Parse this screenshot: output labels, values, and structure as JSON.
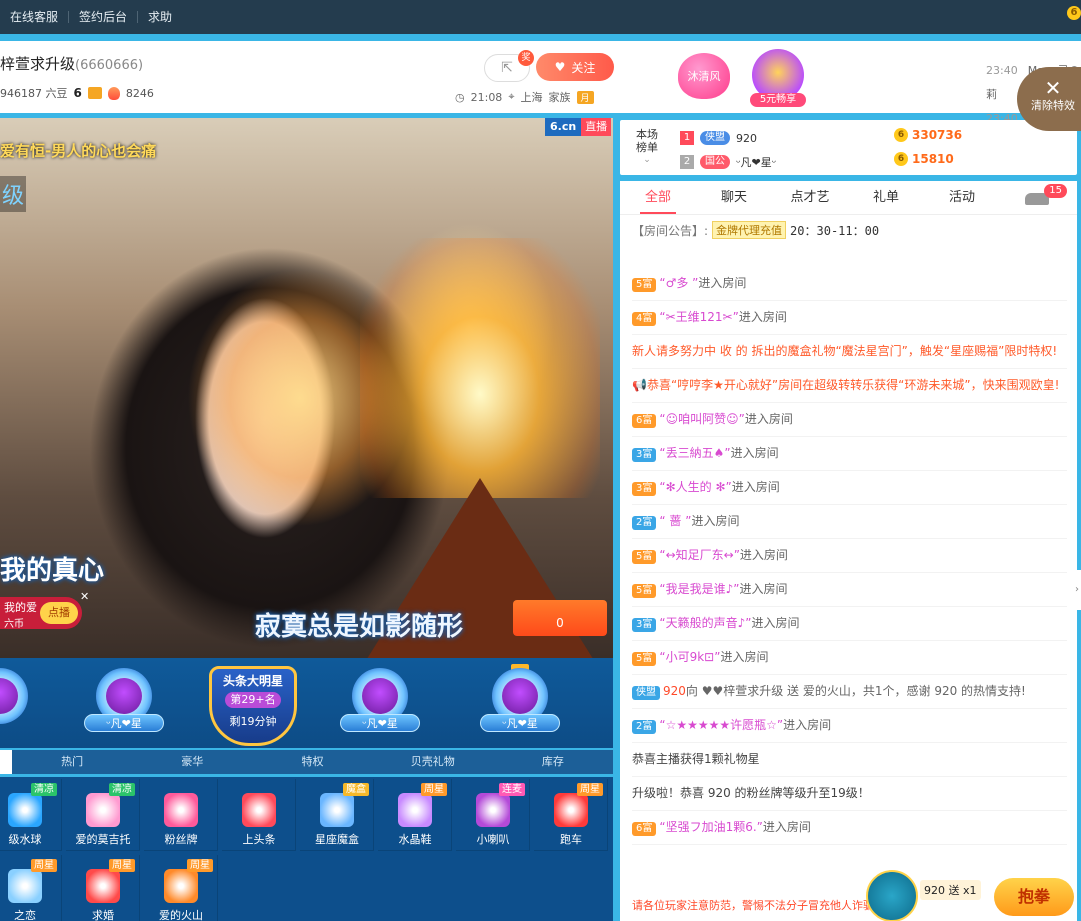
{
  "topbar": {
    "links": [
      "在线客服",
      "签约后台",
      "求助"
    ],
    "coin": "6"
  },
  "header": {
    "title": "梓萱求升级",
    "room_id": "(6660666)",
    "meta_id": "946187 六豆",
    "level": "6",
    "hot": "8246",
    "reward_badge": "奖",
    "follow_label": "关注",
    "time": "21:08",
    "location": "上海",
    "family": "家族",
    "month_tag": "月",
    "gift1_name": "沐清风",
    "gift2_label": "5元畅享",
    "chat_preview": [
      {
        "time": "23:40",
        "name": "Mars 灵の莉"
      },
      {
        "time": "23:40",
        "name": ""
      }
    ],
    "clear_fx": "清除特效"
  },
  "video": {
    "top_text": "爱有恒-男人的心也会痛",
    "lvl_text": "级",
    "logo_a": "6.cn",
    "logo_b": "直播",
    "lyric1": "我的真心",
    "lyric2": "寂寞总是如影随形",
    "promo_title": "我的爱",
    "promo_sub": "六币",
    "promo_btn": "点播",
    "pk_value": "0"
  },
  "seats": [
    {
      "name": "ᵕ凡❤星"
    },
    {
      "name": "ᵕ凡❤星"
    },
    {
      "name": "ᵕ凡❤星"
    },
    {
      "name": "ᵕ凡❤星"
    }
  ],
  "champion": {
    "title": "头条大明星",
    "rank": "第29+名",
    "remaining": "剩19分钟"
  },
  "gift_tabs": [
    "热门",
    "豪华",
    "特权",
    "贝壳礼物",
    "库存"
  ],
  "gifts": [
    {
      "label": "级水球",
      "tag": "清凉",
      "tag_type": "green",
      "color": "#2aa6ff"
    },
    {
      "label": "爱的莫吉托",
      "tag": "清凉",
      "tag_type": "green",
      "color": "#ff9ad0"
    },
    {
      "label": "粉丝牌",
      "tag": "",
      "tag_type": "",
      "color": "#ff5a9a"
    },
    {
      "label": "上头条",
      "tag": "",
      "tag_type": "",
      "color": "#ff4a5a"
    },
    {
      "label": "星座魔盒",
      "tag": "魔盒",
      "tag_type": "gold",
      "color": "#6ab6ff"
    },
    {
      "label": "水晶鞋",
      "tag": "周星",
      "tag_type": "orange",
      "color": "#c88aff"
    },
    {
      "label": "小喇叭",
      "tag": "连麦",
      "tag_type": "pink",
      "color": "#b44ad8"
    },
    {
      "label": "跑车",
      "tag": "周星",
      "tag_type": "orange",
      "color": "#ff3a3a"
    },
    {
      "label": "之恋",
      "tag": "周星",
      "tag_type": "orange",
      "color": "#8ad0ff"
    },
    {
      "label": "求婚",
      "tag": "周星",
      "tag_type": "orange",
      "color": "#ff4a4a"
    },
    {
      "label": "爱的火山",
      "tag": "周星",
      "tag_type": "orange",
      "color": "#ff8a2a"
    }
  ],
  "rank": {
    "label_line1": "本场",
    "label_line2": "榜单",
    "rows": [
      {
        "num": "1",
        "badge": "侠盟",
        "badge_type": "blue",
        "name": "920",
        "coins": "330736"
      },
      {
        "num": "2",
        "badge": "国公",
        "badge_type": "red",
        "name": "ᵕ凡❤星ᵕ",
        "coins": "15810"
      }
    ]
  },
  "chat": {
    "tabs": [
      "全部",
      "聊天",
      "点才艺",
      "礼单",
      "活动"
    ],
    "car_badge": "15",
    "notice_label": "【房间公告】:",
    "notice_gold": "金牌代理充值",
    "notice_time": "20：30-11：00",
    "messages": [
      {
        "rank": "5富",
        "rank_type": "orange",
        "user": "“♂多 ”",
        "text": "进入房间"
      },
      {
        "rank": "4富",
        "rank_type": "orange",
        "user": "“✂王维121✂”",
        "text": "进入房间"
      },
      {
        "rank": "",
        "rank_type": "",
        "user": "",
        "text": "新人请多努力中 收 的 拆出的魔盒礼物“魔法星宫门”，触发“星座赐福”限时特权!",
        "style": "sys"
      },
      {
        "rank": "",
        "rank_type": "",
        "user": "",
        "text": "📢恭喜“哼哼李★开心就好”房间在超级转转乐获得“环游未来城”，快来围观欧皇!",
        "style": "sys"
      },
      {
        "rank": "6富",
        "rank_type": "orange",
        "user": "“☺咱叫阿赞☺”",
        "text": "进入房间"
      },
      {
        "rank": "3富",
        "rank_type": "blue",
        "user": "“丢三納五♠”",
        "text": "进入房间"
      },
      {
        "rank": "3富",
        "rank_type": "orange",
        "user": "“✻人生的 ✻”",
        "text": "进入房间"
      },
      {
        "rank": "2富",
        "rank_type": "blue",
        "user": "“ 蔷 ”",
        "text": "进入房间"
      },
      {
        "rank": "5富",
        "rank_type": "orange",
        "user": "“↔知足厂东↔”",
        "text": "进入房间"
      },
      {
        "rank": "5富",
        "rank_type": "orange",
        "user": "“我是我是谁♪”",
        "text": "进入房间"
      },
      {
        "rank": "3富",
        "rank_type": "blue",
        "user": "“天籁般的声音♪”",
        "text": "进入房间"
      },
      {
        "rank": "5富",
        "rank_type": "orange",
        "user": "“小可9k⊡”",
        "text": "进入房间"
      },
      {
        "rank": "侠盟",
        "rank_type": "blue",
        "user": "920",
        "text": "向 ♥♥梓萱求升级 送 爱的火山，共1个，感谢 920 的热情支持!",
        "style": "gift"
      },
      {
        "rank": "2富",
        "rank_type": "blue",
        "user": "“☆★★★★★许愿瓶☆”",
        "text": "进入房间"
      },
      {
        "rank": "",
        "rank_type": "",
        "user": "",
        "text": "恭喜主播获得1颗礼物星",
        "style": "blk"
      },
      {
        "rank": "",
        "rank_type": "",
        "user": "",
        "text": "升级啦！恭喜 920 的粉丝牌等级升至19级！",
        "style": "blk"
      },
      {
        "rank": "6富",
        "rank_type": "orange",
        "user": "“坚强フ加油1颗6.”",
        "text": "进入房间"
      }
    ],
    "warning": "请各位玩家注意防范，警惕不法分子冒充他人诈骗"
  },
  "bottom_gift": {
    "sender": "920",
    "sent": "送",
    "count": "x1",
    "btn": "抱拳"
  }
}
